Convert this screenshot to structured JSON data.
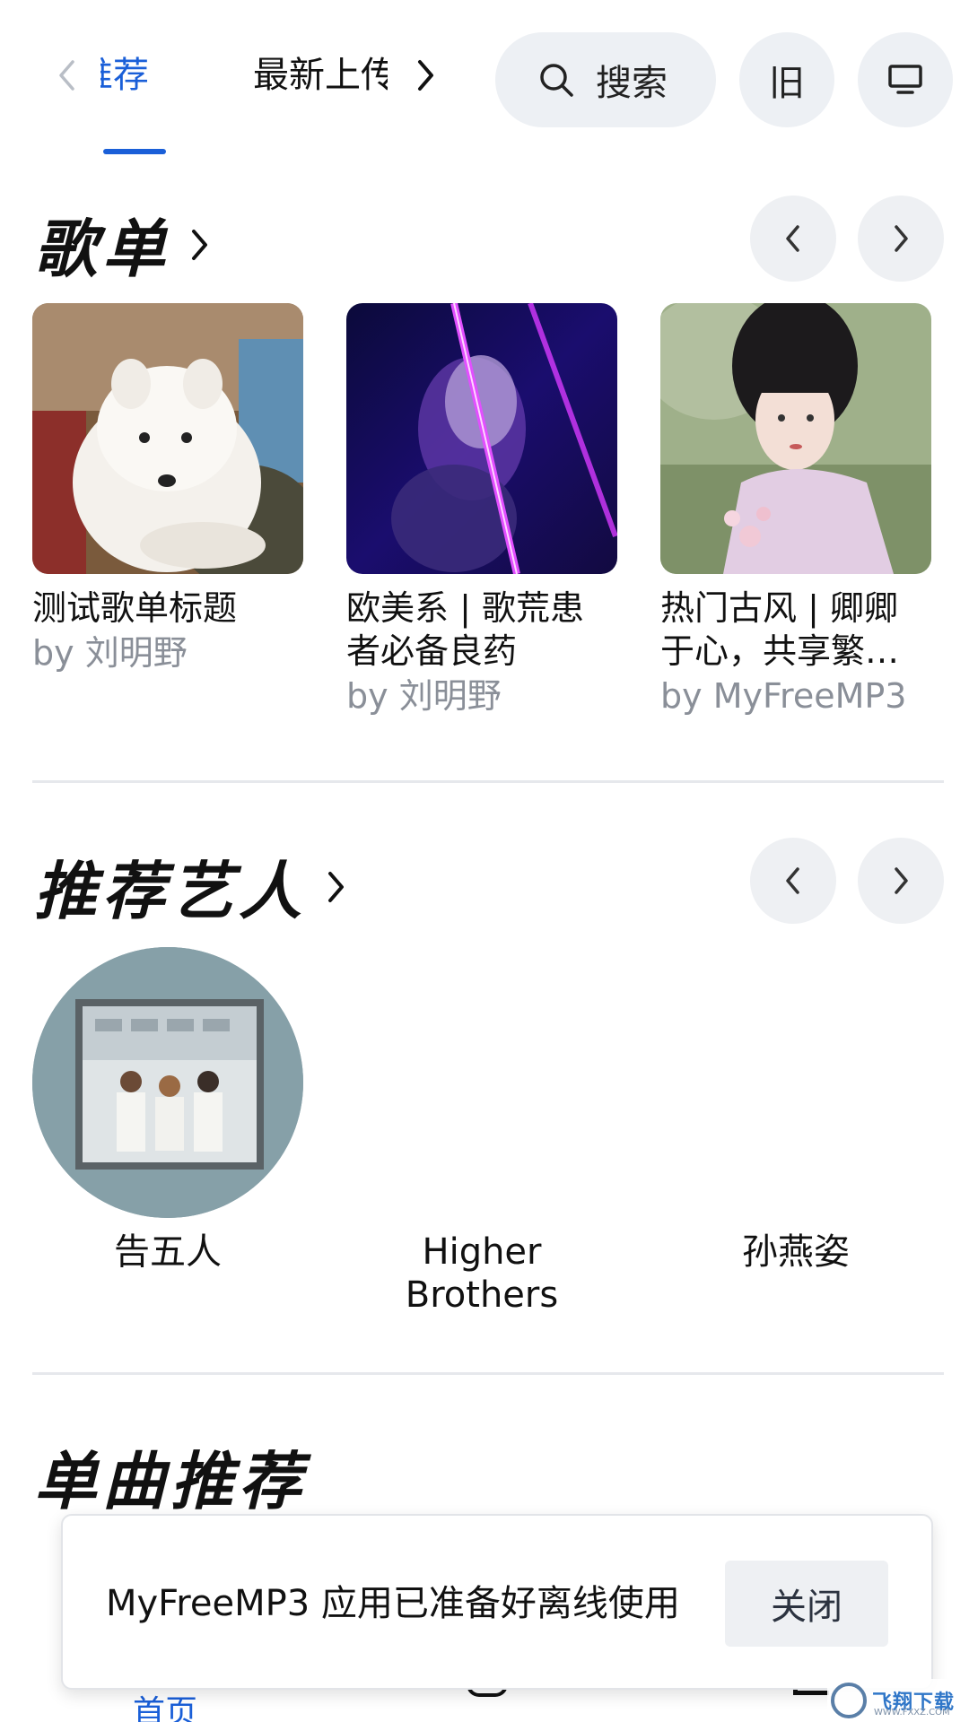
{
  "header": {
    "tabs": [
      {
        "label": "推荐",
        "active": true
      },
      {
        "label": "最新上传",
        "active": false
      }
    ],
    "search_label": "搜索",
    "old_label": "旧",
    "accent_color": "#1a5fd8"
  },
  "playlists": {
    "title": "歌单",
    "items": [
      {
        "title": "测试歌单标题",
        "by": "by 刘明野"
      },
      {
        "title": "欧美系 | 歌荒患者必备良药",
        "by": "by 刘明野"
      },
      {
        "title": "热门古风 | 卿卿于心，共享繁…",
        "by": "by MyFreeMP3"
      }
    ]
  },
  "artists": {
    "title": "推荐艺人",
    "items": [
      {
        "name": "告五人"
      },
      {
        "name": "Higher Brothers"
      },
      {
        "name": "孙燕姿"
      }
    ]
  },
  "singles": {
    "title": "单曲推荐"
  },
  "toast": {
    "message": "MyFreeMP3 应用已准备好离线使用",
    "close_label": "关闭"
  },
  "bottom_nav": {
    "home_label": "首页"
  },
  "watermark": {
    "text": "飞翔下载",
    "sub": "WWW.FXXZ.COM"
  }
}
